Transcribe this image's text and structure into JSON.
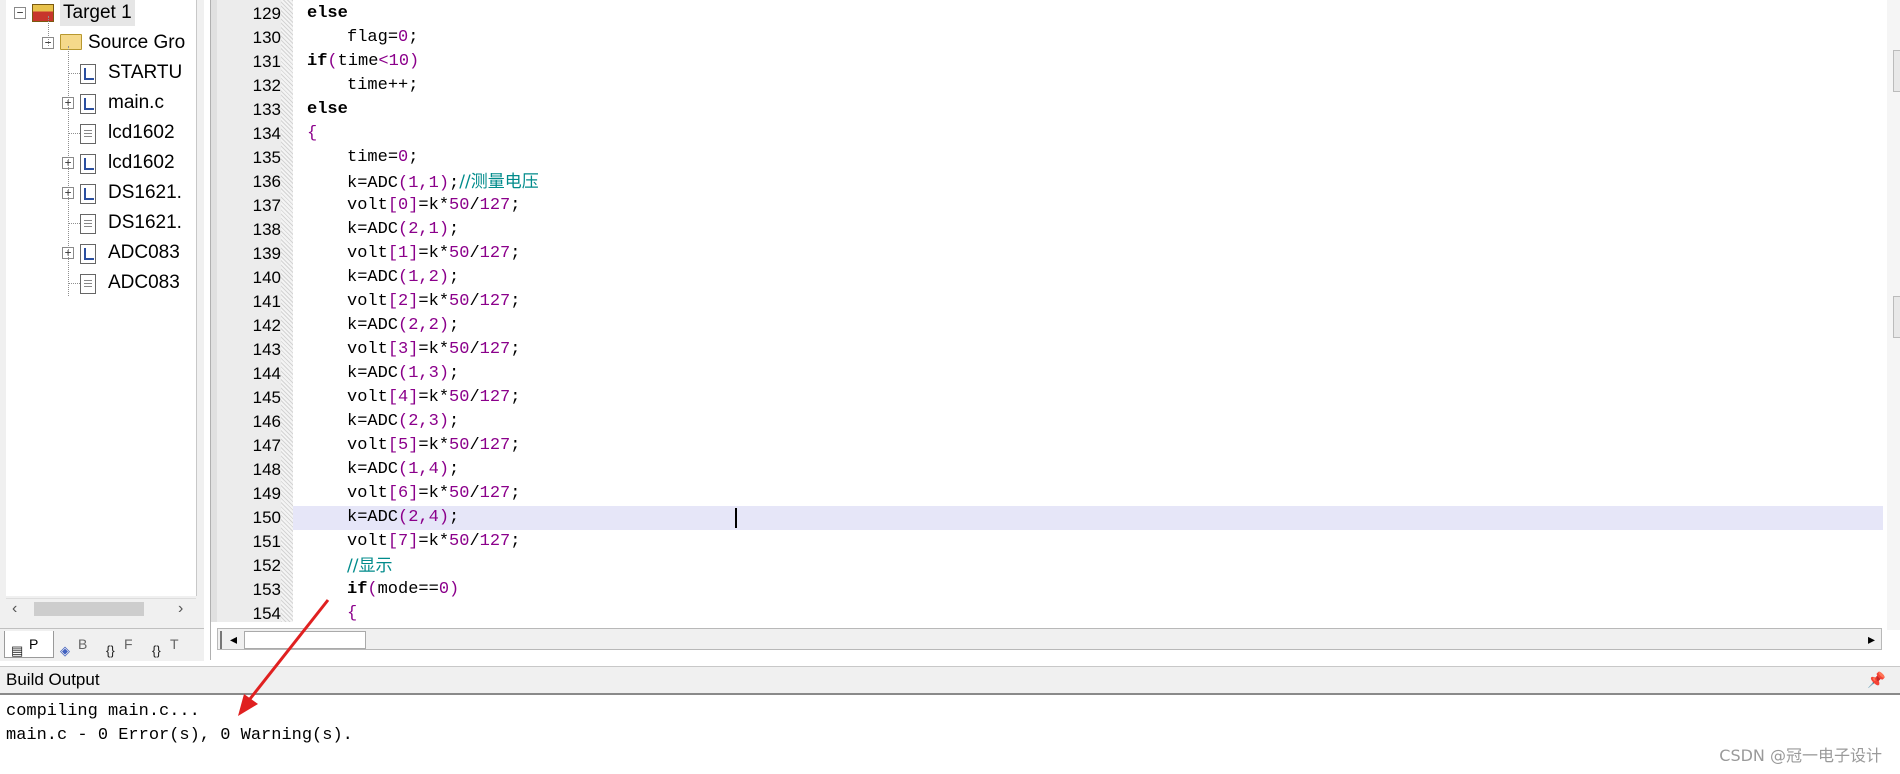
{
  "project_tree": {
    "items": [
      {
        "label": "Target 1",
        "depth": 0,
        "kind": "target",
        "expander": "−"
      },
      {
        "label": "Source Gro",
        "depth": 1,
        "kind": "folder",
        "expander": "−"
      },
      {
        "label": "STARTU",
        "depth": 2,
        "kind": "file-hdr",
        "expander": ""
      },
      {
        "label": "main.c",
        "depth": 2,
        "kind": "file-hdr",
        "expander": "+"
      },
      {
        "label": "lcd1602",
        "depth": 2,
        "kind": "file",
        "expander": ""
      },
      {
        "label": "lcd1602",
        "depth": 2,
        "kind": "file-hdr",
        "expander": "+"
      },
      {
        "label": "DS1621.",
        "depth": 2,
        "kind": "file-hdr",
        "expander": "+"
      },
      {
        "label": "DS1621.",
        "depth": 2,
        "kind": "file",
        "expander": ""
      },
      {
        "label": "ADC083",
        "depth": 2,
        "kind": "file-hdr",
        "expander": "+"
      },
      {
        "label": "ADC083",
        "depth": 2,
        "kind": "file",
        "expander": ""
      }
    ]
  },
  "panel_tabs": [
    {
      "label": "P",
      "active": true
    },
    {
      "label": "B",
      "active": false
    },
    {
      "label": "F",
      "active": false
    },
    {
      "label": "T",
      "active": false
    }
  ],
  "editor": {
    "lines": [
      {
        "n": "129",
        "indent": 1,
        "text": "else"
      },
      {
        "n": "130",
        "indent": 2,
        "text": "flag=0;"
      },
      {
        "n": "131",
        "indent": 1,
        "text": "if(time<10)"
      },
      {
        "n": "132",
        "indent": 2,
        "text": "time++;"
      },
      {
        "n": "133",
        "indent": 1,
        "text": "else"
      },
      {
        "n": "134",
        "indent": 1,
        "text": "{"
      },
      {
        "n": "135",
        "indent": 2,
        "text": "time=0;"
      },
      {
        "n": "136",
        "indent": 2,
        "text": "k=ADC(1,1);//测量电压"
      },
      {
        "n": "137",
        "indent": 2,
        "text": "volt[0]=k*50/127;"
      },
      {
        "n": "138",
        "indent": 2,
        "text": "k=ADC(2,1);"
      },
      {
        "n": "139",
        "indent": 2,
        "text": "volt[1]=k*50/127;"
      },
      {
        "n": "140",
        "indent": 2,
        "text": "k=ADC(1,2);"
      },
      {
        "n": "141",
        "indent": 2,
        "text": "volt[2]=k*50/127;"
      },
      {
        "n": "142",
        "indent": 2,
        "text": "k=ADC(2,2);"
      },
      {
        "n": "143",
        "indent": 2,
        "text": "volt[3]=k*50/127;"
      },
      {
        "n": "144",
        "indent": 2,
        "text": "k=ADC(1,3);"
      },
      {
        "n": "145",
        "indent": 2,
        "text": "volt[4]=k*50/127;"
      },
      {
        "n": "146",
        "indent": 2,
        "text": "k=ADC(2,3);"
      },
      {
        "n": "147",
        "indent": 2,
        "text": "volt[5]=k*50/127;"
      },
      {
        "n": "148",
        "indent": 2,
        "text": "k=ADC(1,4);"
      },
      {
        "n": "149",
        "indent": 2,
        "text": "volt[6]=k*50/127;"
      },
      {
        "n": "150",
        "indent": 2,
        "text": "k=ADC(2,4);",
        "current": true
      },
      {
        "n": "151",
        "indent": 2,
        "text": "volt[7]=k*50/127;"
      },
      {
        "n": "152",
        "indent": 2,
        "text": "//显示"
      },
      {
        "n": "153",
        "indent": 2,
        "text": "if(mode==0)"
      },
      {
        "n": "154",
        "indent": 2,
        "text": "{"
      }
    ]
  },
  "build_output": {
    "title": "Build Output",
    "lines": [
      "compiling main.c...",
      "main.c - 0 Error(s), 0 Warning(s)."
    ]
  },
  "watermark": "CSDN @冠一电子设计",
  "colors": {
    "numbers": "#8b008b",
    "comments": "#008b8b",
    "current_line": "#e6e6f8",
    "annotation_arrow": "#e02020"
  }
}
